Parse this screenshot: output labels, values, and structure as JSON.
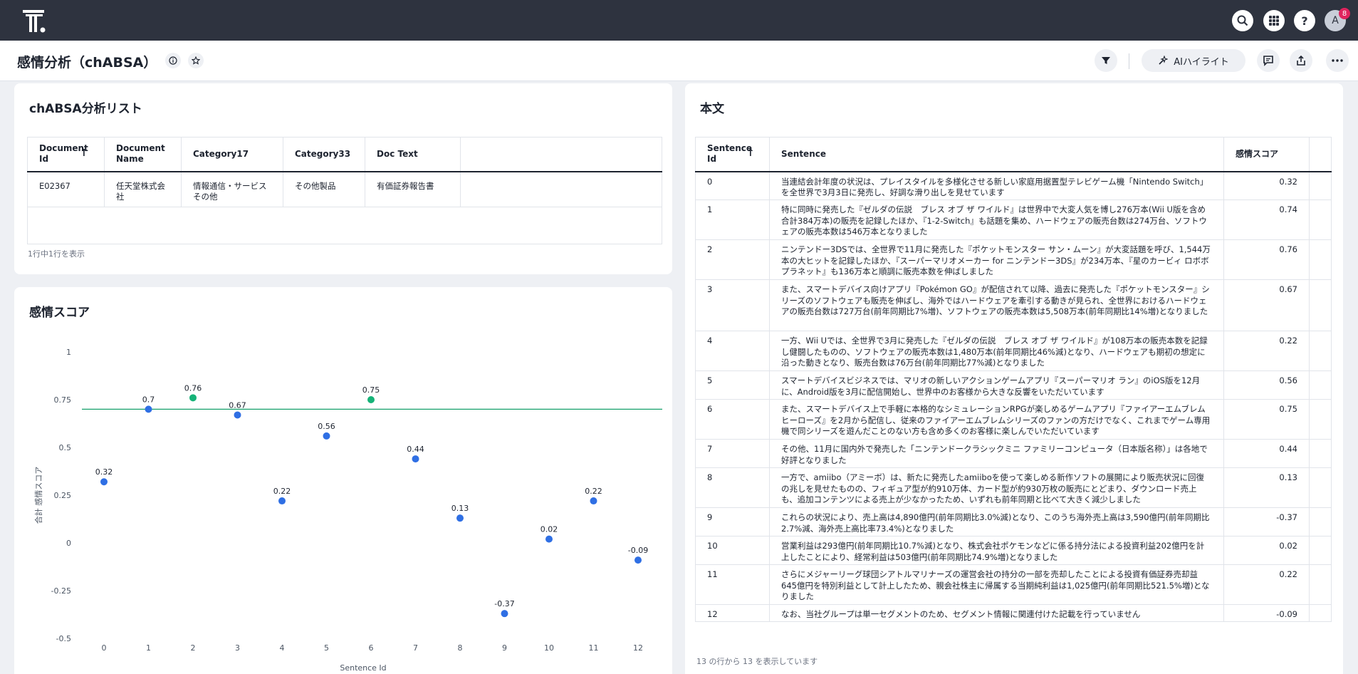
{
  "app": {
    "avatar_initial": "A",
    "notification_count": "8"
  },
  "header": {
    "title": "感情分析（chABSA）",
    "ai_button_label": "AIハイライト"
  },
  "list_card": {
    "title": "chABSA分析リスト",
    "columns": [
      "Document Id",
      "Document Name",
      "Category17",
      "Category33",
      "Doc Text"
    ],
    "rows": [
      [
        "E02367",
        "任天堂株式会社",
        "情報通信・サービスその他",
        "その他製品",
        "有価証券報告書"
      ]
    ],
    "footer": "1行中1行を表示"
  },
  "score_card": {
    "title": "感情スコア"
  },
  "chart_data": {
    "type": "scatter",
    "xlabel": "Sentence Id",
    "ylabel": "合計 感情スコア",
    "categories": [
      "0",
      "1",
      "2",
      "3",
      "4",
      "5",
      "6",
      "7",
      "8",
      "9",
      "10",
      "11",
      "12"
    ],
    "values": [
      0.32,
      0.7,
      0.76,
      0.67,
      0.22,
      0.56,
      0.75,
      0.44,
      0.13,
      -0.37,
      0.02,
      0.22,
      -0.09
    ],
    "value_labels": [
      "0.32",
      "0.7",
      "0.76",
      "0.67",
      "0.22",
      "0.56",
      "0.75",
      "0.44",
      "0.13",
      "-0.37",
      "0.02",
      "0.22",
      "-0.09"
    ],
    "highlighted": [
      false,
      false,
      true,
      false,
      false,
      false,
      true,
      false,
      false,
      false,
      false,
      false,
      false
    ],
    "reference_line": 0.7,
    "yticks": [
      1,
      0.75,
      0.5,
      0.25,
      0,
      -0.25,
      -0.5
    ],
    "ytick_labels": [
      "1",
      "0.75",
      "0.5",
      "0.25",
      "0",
      "-0.25",
      "-0.5"
    ],
    "ylim": [
      -0.5,
      1
    ],
    "colors": {
      "point": "#2f6fe4",
      "highlight": "#16b378",
      "reference_line": "#16a06b"
    },
    "grid": false
  },
  "text_card": {
    "title": "本文",
    "columns": [
      "Sentence Id",
      "Sentence",
      "感情スコア"
    ],
    "rows": [
      [
        "0",
        "当連結会計年度の状況は、プレイスタイルを多様化させる新しい家庭用据置型テレビゲーム機「Nintendo Switch」を全世界で3月3日に発売し、好調な滑り出しを見せています",
        "0.32"
      ],
      [
        "1",
        "特に同時に発売した『ゼルダの伝説　ブレス オブ ザ ワイルド』は世界中で大変人気を博し276万本(Wii U版を含め合計384万本)の販売を記録したほか、『1-2-Switch』も話題を集め、ハードウェアの販売台数は274万台、ソフトウェアの販売本数は546万本となりました",
        "0.74"
      ],
      [
        "2",
        "ニンテンドー3DSでは、全世界で11月に発売した『ポケットモンスター サン・ムーン』が大変話題を呼び、1,544万本の大ヒットを記録したほか、『スーパーマリオメーカー for ニンテンドー3DS』が234万本、『星のカービィ ロボボプラネット』も136万本と順調に販売本数を伸ばしました",
        "0.76"
      ],
      [
        "3",
        "また、スマートデバイス向けアプリ『Pokémon GO』が配信されて以降、過去に発売した『ポケットモンスター』シリーズのソフトウェアも販売を伸ばし、海外ではハードウェアを牽引する動きが見られ、全世界におけるハードウェアの販売台数は727万台(前年同期比7%増)、ソフトウェアの販売本数は5,508万本(前年同期比14%増)となりました",
        "0.67"
      ],
      [
        "4",
        "一方、Wii Uでは、全世界で3月に発売した『ゼルダの伝説　ブレス オブ ザ ワイルド』が108万本の販売本数を記録し健闘したものの、ソフトウェアの販売本数は1,480万本(前年同期比46%減)となり、ハードウェアも期初の想定に沿った動きとなり、販売台数は76万台(前年同期比77%減)となりました",
        "0.22"
      ],
      [
        "5",
        "スマートデバイスビジネスでは、マリオの新しいアクションゲームアプリ『スーパーマリオ ラン』のiOS版を12月に、Android版を3月に配信開始し、世界中のお客様から大きな反響をいただいています",
        "0.56"
      ],
      [
        "6",
        "また、スマートデバイス上で手軽に本格的なシミュレーションRPGが楽しめるゲームアプリ『ファイアーエムブレム ヒーローズ』を2月から配信し、従来のファイアーエムブレムシリーズのファンの方だけでなく、これまでゲーム専用機で同シリーズを遊んだことのない方も含め多くのお客様に楽しんでいただいています",
        "0.75"
      ],
      [
        "7",
        "その他、11月に国内外で発売した「ニンテンドークラシックミニ ファミリーコンピュータ（日本版名称）」は各地で好評となりました",
        "0.44"
      ],
      [
        "8",
        "一方で、amiibo（アミーボ）は、新たに発売したamiiboを使って楽しめる新作ソフトの展開により販売状況に回復の兆しを見せたものの、フィギュア型が約910万体、カード型が約930万枚の販売にとどまり、ダウンロード売上も、追加コンテンツによる売上が少なかったため、いずれも前年同期と比べて大きく減少しました",
        "0.13"
      ],
      [
        "9",
        "これらの状況により、売上高は4,890億円(前年同期比3.0%減)となり、このうち海外売上高は3,590億円(前年同期比2.7%減、海外売上高比率73.4%)となりました",
        "-0.37"
      ],
      [
        "10",
        "営業利益は293億円(前年同期比10.7%減)となり、株式会社ポケモンなどに係る持分法による投資利益202億円を計上したことにより、経常利益は503億円(前年同期比74.9%増)となりました",
        "0.02"
      ],
      [
        "11",
        "さらにメジャーリーグ球団シアトルマリナーズの運営会社の持分の一部を売却したことによる投資有価証券売却益645億円を特別利益として計上したため、親会社株主に帰属する当期純利益は1,025億円(前年同期比521.5%増)となりました",
        "0.22"
      ],
      [
        "12",
        "なお、当社グループは単一セグメントのため、セグメント情報に関連付けた記載を行っていません",
        "-0.09"
      ]
    ],
    "footer": "13 の行から 13 を表示しています"
  }
}
